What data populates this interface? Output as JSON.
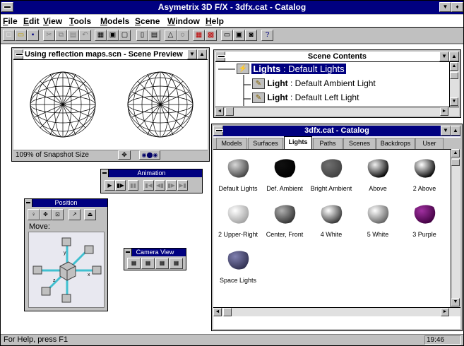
{
  "app": {
    "title": "Asymetrix 3D F/X - 3dfx.cat - Catalog"
  },
  "menu": [
    {
      "label": "File",
      "u": "F"
    },
    {
      "label": "Edit",
      "u": "E"
    },
    {
      "label": "View",
      "u": "V"
    },
    {
      "label": "Tools",
      "u": "T"
    },
    {
      "label": "Models",
      "u": "M"
    },
    {
      "label": "Scene",
      "u": "S"
    },
    {
      "label": "Window",
      "u": "W"
    },
    {
      "label": "Help",
      "u": "H"
    }
  ],
  "scene_preview": {
    "title": "Using reflection maps.scn - Scene Preview",
    "status": "109% of Snapshot Size"
  },
  "scene_contents": {
    "title": "Scene Contents",
    "root": {
      "name": "Lights",
      "desc": " : Default Lights"
    },
    "children": [
      {
        "name": "Light",
        "desc": " : Default Ambient Light"
      },
      {
        "name": "Light",
        "desc": " : Default Left Light"
      }
    ]
  },
  "catalog": {
    "title": "3dfx.cat - Catalog",
    "tabs": [
      "Models",
      "Surfaces",
      "Lights",
      "Paths",
      "Scenes",
      "Backdrops",
      "User"
    ],
    "active_tab": "Lights",
    "items": [
      {
        "label": "Default Lights",
        "color": "#d8d8d8",
        "shade": "#404040"
      },
      {
        "label": "Def. Ambient",
        "color": "#101010",
        "shade": "#000000"
      },
      {
        "label": "Bright Ambient",
        "color": "#707070",
        "shade": "#404040"
      },
      {
        "label": "Above",
        "color": "#f0f0f0",
        "shade": "#000000"
      },
      {
        "label": "2 Above",
        "color": "#ffffff",
        "shade": "#000000"
      },
      {
        "label": "2 Upper-Right",
        "color": "#ffffff",
        "shade": "#a0a0a0"
      },
      {
        "label": "Center, Front",
        "color": "#b0b0b0",
        "shade": "#303030"
      },
      {
        "label": "4 White",
        "color": "#ffffff",
        "shade": "#303030"
      },
      {
        "label": "5 White",
        "color": "#ffffff",
        "shade": "#606060"
      },
      {
        "label": "3 Purple",
        "color": "#a030a0",
        "shade": "#400040"
      },
      {
        "label": "Space Lights",
        "color": "#8080b0",
        "shade": "#303050"
      }
    ]
  },
  "animation": {
    "title": "Animation"
  },
  "position": {
    "title": "Position",
    "move_label": "Move:"
  },
  "camera_view": {
    "title": "Camera View"
  },
  "status": {
    "help": "For Help, press F1",
    "time": "19:46"
  }
}
